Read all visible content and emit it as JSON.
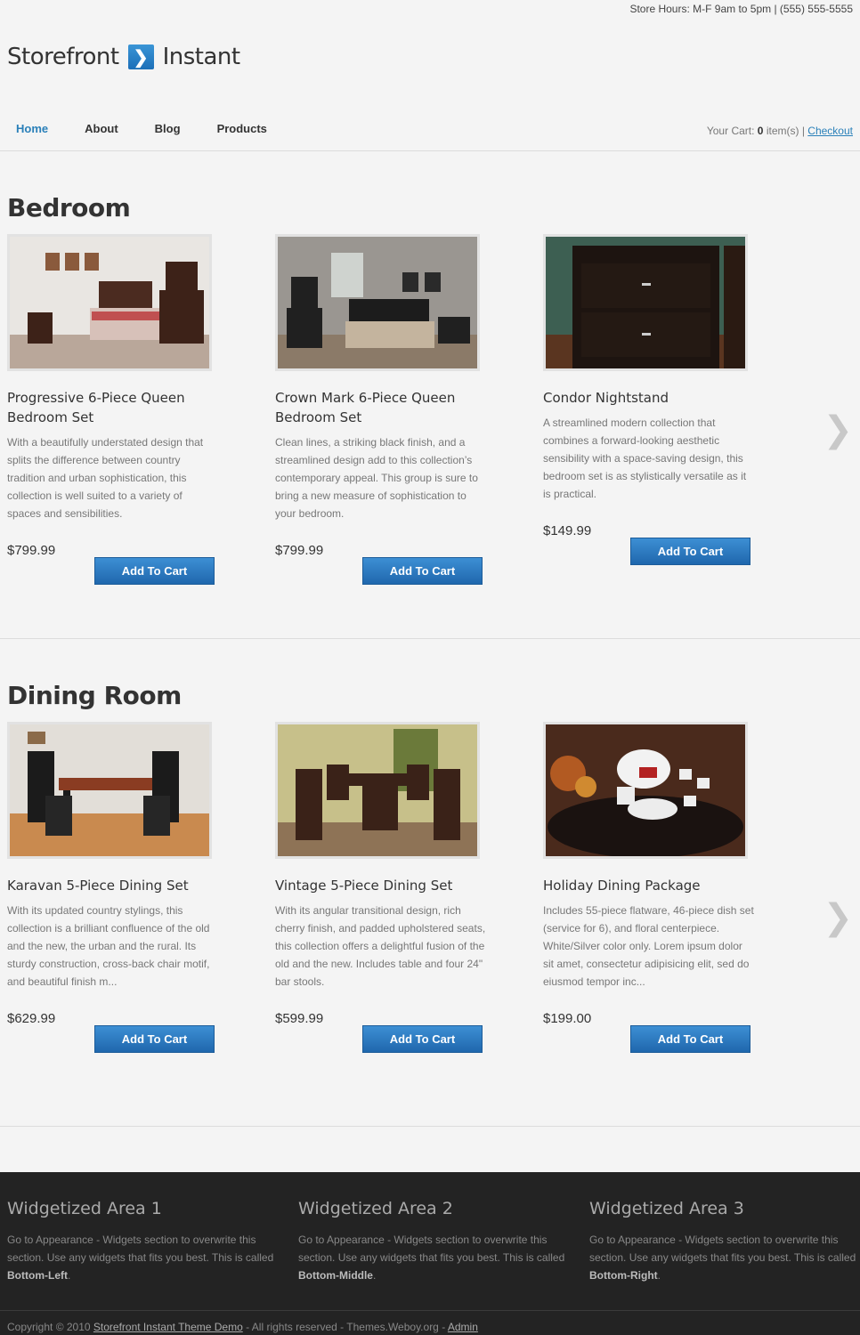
{
  "header": {
    "store_hours": "Store Hours: M-F 9am to 5pm | (555) 555-5555",
    "logo_left": "Storefront",
    "logo_arrow": "❯",
    "logo_right": "Instant"
  },
  "nav": {
    "items": [
      "Home",
      "About",
      "Blog",
      "Products"
    ],
    "active": "Home"
  },
  "cart": {
    "label": "Your Cart:",
    "count": "0",
    "suffix": "item(s) |",
    "checkout": "Checkout"
  },
  "sections": [
    {
      "title": "Bedroom",
      "products": [
        {
          "name": "Progressive 6-Piece Queen Bedroom Set",
          "description": "With a beautifully understated design that splits the difference between country tradition and urban sophistication, this collection is well suited to a variety of spaces and sensibilities.",
          "price": "$799.99",
          "button": "Add To Cart"
        },
        {
          "name": "Crown Mark 6-Piece Queen Bedroom Set",
          "description": "Clean lines, a striking black finish, and a streamlined design add to this collection’s contemporary appeal. This group is sure to bring a new measure of sophistication to your bedroom.",
          "price": "$799.99",
          "button": "Add To Cart"
        },
        {
          "name": "Condor Nightstand",
          "description": "A streamlined modern collection that combines a forward-looking aesthetic sensibility with a space-saving design, this bedroom set is as stylistically versatile as it is practical.",
          "price": "$149.99",
          "button": "Add To Cart"
        }
      ]
    },
    {
      "title": "Dining Room",
      "products": [
        {
          "name": "Karavan 5-Piece Dining Set",
          "description": "With its updated country stylings, this collection is a brilliant confluence of the old and the new, the urban and the rural. Its sturdy construction, cross-back chair motif, and beautiful finish m...",
          "price": "$629.99",
          "button": "Add To Cart"
        },
        {
          "name": "Vintage 5-Piece Dining Set",
          "description": "With its angular transitional design, rich cherry finish, and padded upholstered seats, this collection offers a delightful fusion of the old and the new. Includes table and four 24\" bar stools.",
          "price": "$599.99",
          "button": "Add To Cart"
        },
        {
          "name": "Holiday Dining Package",
          "description": "Includes 55-piece flatware, 46-piece dish set (service for 6), and floral centerpiece.  White/Silver color only.  Lorem ipsum dolor sit amet, consectetur adipisicing elit, sed do eiusmod tempor inc...",
          "price": "$199.00",
          "button": "Add To Cart"
        }
      ]
    }
  ],
  "next_arrow": "❯",
  "footer": {
    "widgets": [
      {
        "title": "Widgetized Area 1",
        "text": "Go to Appearance - Widgets section to overwrite this section. Use any widgets that fits you best. This is called ",
        "name": "Bottom-Left",
        "end": "."
      },
      {
        "title": "Widgetized Area 2",
        "text": "Go to Appearance - Widgets section to overwrite this section. Use any widgets that fits you best. This is called ",
        "name": "Bottom-Middle",
        "end": "."
      },
      {
        "title": "Widgetized Area 3",
        "text": "Go to Appearance - Widgets section to overwrite this section. Use any widgets that fits you best. This is called ",
        "name": "Bottom-Right",
        "end": "."
      }
    ],
    "copyright_prefix": "Copyright © 2010",
    "copyright_link": "Storefront Instant Theme Demo",
    "copyright_middle": "- All rights reserved - Themes.Weboy.org -",
    "admin_link": "Admin"
  }
}
